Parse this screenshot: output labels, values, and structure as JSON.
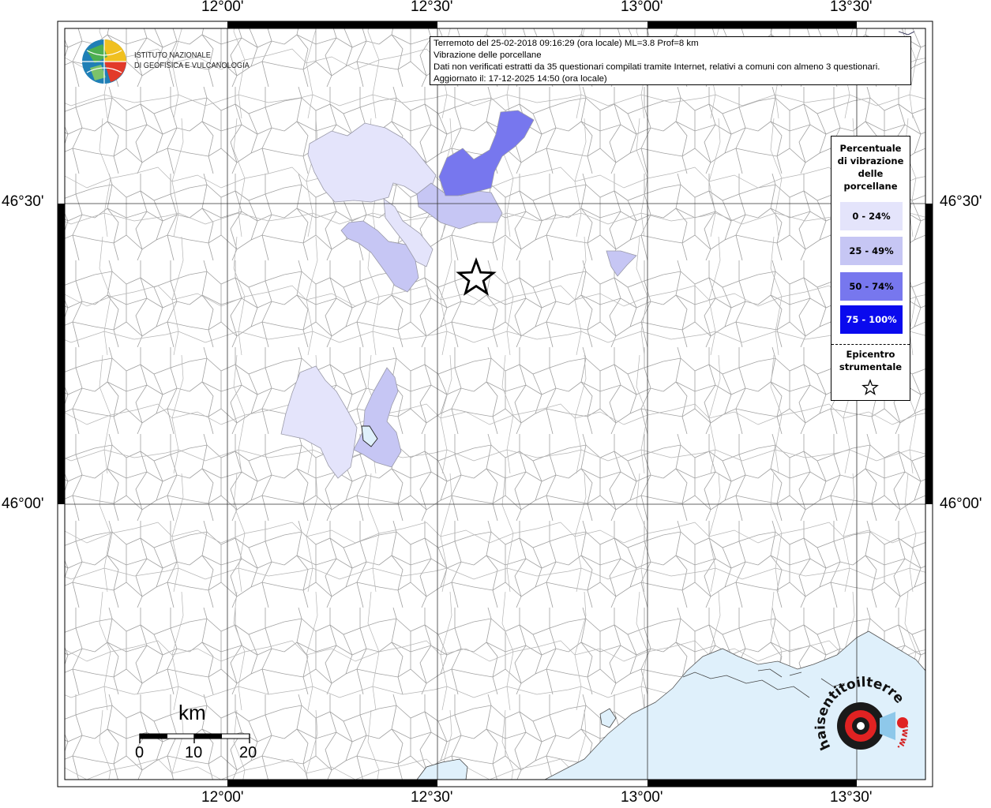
{
  "map": {
    "lon_ticks": [
      "12°00'",
      "12°30'",
      "13°00'",
      "13°30'"
    ],
    "lat_ticks": [
      "46°30'",
      "46°00'"
    ]
  },
  "institute": {
    "line1": "ISTITUTO NAZIONALE",
    "line2": "DI GEOFISICA E VULCANOLOGIA"
  },
  "info": {
    "line1": "Terremoto del 25-02-2018 09:16:29 (ora locale) ML=3.8 Prof=8 km",
    "line2": "Vibrazione delle porcellane",
    "line3": "Dati non verificati estratti da 35 questionari compilati tramite Internet, relativi a comuni con almeno 3 questionari.",
    "line4": "Aggiornato il: 17-12-2025 14:50 (ora locale)"
  },
  "legend": {
    "title": [
      "Percentuale",
      "di vibrazione",
      "delle",
      "porcellane"
    ],
    "classes": [
      {
        "label": "0 - 24%",
        "color": "#e4e4fb"
      },
      {
        "label": "25 - 49%",
        "color": "#c6c6f4"
      },
      {
        "label": "50 - 74%",
        "color": "#7777ee"
      },
      {
        "label": "75 - 100%",
        "color": "#0a0aee"
      }
    ],
    "epicenter": [
      "Epicentro",
      "strumentale"
    ]
  },
  "scalebar": {
    "unit": "km",
    "labels": [
      "0",
      "10",
      "20"
    ]
  },
  "badge": {
    "text": "haisentitoilterremoto.it",
    "www": "www."
  },
  "colors": {
    "sea": "#dff0fb",
    "border": "#9a9a9a"
  }
}
